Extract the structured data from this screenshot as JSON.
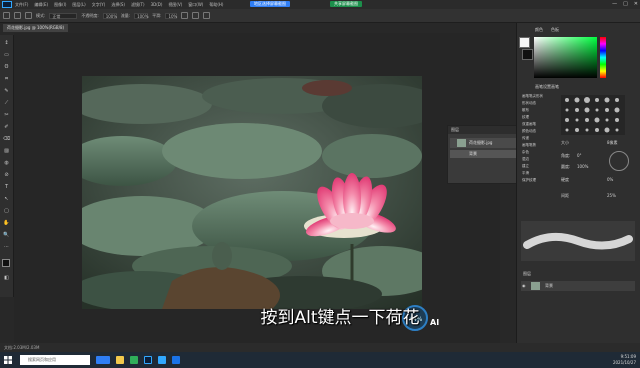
{
  "menubar": {
    "items": [
      "文件(F)",
      "编辑(E)",
      "图像(I)",
      "图层(L)",
      "文字(Y)",
      "选择(S)",
      "滤镜(T)",
      "3D(D)",
      "视图(V)",
      "窗口(W)",
      "帮助(H)"
    ],
    "btn_a": "地区选择屏幕截图",
    "btn_b": "共享屏幕截图",
    "win_controls": [
      "—",
      "□",
      "✕"
    ]
  },
  "options": {
    "mode_label": "模式:",
    "mode_value": "正常",
    "opacity_label": "不透明度:",
    "opacity_value": "100%",
    "flow_label": "流量:",
    "flow_value": "100%",
    "smooth_label": "平滑:",
    "smooth_value": "10%"
  },
  "document": {
    "tab": "荷花摄影.jpg @ 100%(RGB/8)"
  },
  "tools": [
    "↕",
    "▭",
    "ʘ",
    "⌗",
    "✎",
    "⟋",
    "✂",
    "✐",
    "⌫",
    "▨",
    "◍",
    "⊘",
    "T",
    "↖",
    "▢",
    "✋",
    "🔍",
    "⋯",
    "◼",
    "◻",
    "◧"
  ],
  "layers_panel": {
    "header": "图层",
    "layer1": "荷花摄影.jpg",
    "layer2": "背景"
  },
  "right": {
    "color_tab": "颜色",
    "swatch_tab": "色板",
    "brush_tab": "画笔设置",
    "brush_tab2": "画笔",
    "brush_items": [
      "画笔笔尖形状",
      "形状动态",
      "散布",
      "纹理",
      "双重画笔",
      "颜色动态",
      "传递",
      "画笔笔势",
      "杂色",
      "湿边",
      "建立",
      "平滑",
      "保护纹理"
    ],
    "size_label": "大小",
    "size_value": "8像素",
    "angle_label": "角度:",
    "angle_value": "0°",
    "roundness_label": "圆度:",
    "roundness_value": "100%",
    "hardness_label": "硬度",
    "hardness_value": "0%",
    "spacing_label": "间距",
    "spacing_value": "25%",
    "layers_tab": "图层",
    "layer_name": "背景"
  },
  "status": {
    "text": "文档:2.03M/2.03M"
  },
  "subtitle": "按到Alt键点一下荷花",
  "badge": {
    "percent": "44%",
    "label": "AI"
  },
  "taskbar": {
    "search": "搜索网页和应用",
    "clock": "9:51:09",
    "date": "2021/10/27"
  },
  "colors": {
    "accent": "#31a8ff",
    "menu_btn_a": "#2f7ef5",
    "menu_btn_b": "#1c8f4b"
  }
}
